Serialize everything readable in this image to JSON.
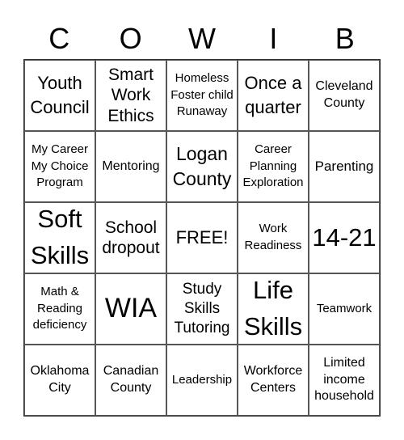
{
  "header": {
    "letters": [
      "C",
      "O",
      "W",
      "I",
      "B"
    ]
  },
  "board": {
    "cells": [
      {
        "text": "Youth Council",
        "size": "s22"
      },
      {
        "text": "Smart Work Ethics",
        "size": "s21"
      },
      {
        "text": "Homeless Foster child Runaway",
        "size": "s15"
      },
      {
        "text": "Once a quarter",
        "size": "s22"
      },
      {
        "text": "Cleveland County",
        "size": "s16"
      },
      {
        "text": "My Career My Choice Program",
        "size": "s15"
      },
      {
        "text": "Mentoring",
        "size": "s16"
      },
      {
        "text": "Logan County",
        "size": "s23"
      },
      {
        "text": "Career Planning Exploration",
        "size": "s15"
      },
      {
        "text": "Parenting",
        "size": "s17"
      },
      {
        "text": "Soft Skills",
        "size": "s31"
      },
      {
        "text": "School dropout",
        "size": "s21"
      },
      {
        "text": "FREE!",
        "size": "s22"
      },
      {
        "text": "Work Readiness",
        "size": "s15"
      },
      {
        "text": "14-21",
        "size": "s31"
      },
      {
        "text": "Math & Reading deficiency",
        "size": "s15"
      },
      {
        "text": "WIA",
        "size": "s34"
      },
      {
        "text": "Study Skills Tutoring",
        "size": "s19"
      },
      {
        "text": "Life Skills",
        "size": "s31"
      },
      {
        "text": "Teamwork",
        "size": "s15"
      },
      {
        "text": "Oklahoma City",
        "size": "s16"
      },
      {
        "text": "Canadian County",
        "size": "s16"
      },
      {
        "text": "Leadership",
        "size": "s15"
      },
      {
        "text": "Workforce Centers",
        "size": "s16"
      },
      {
        "text": "Limited income household",
        "size": "s16"
      }
    ]
  }
}
